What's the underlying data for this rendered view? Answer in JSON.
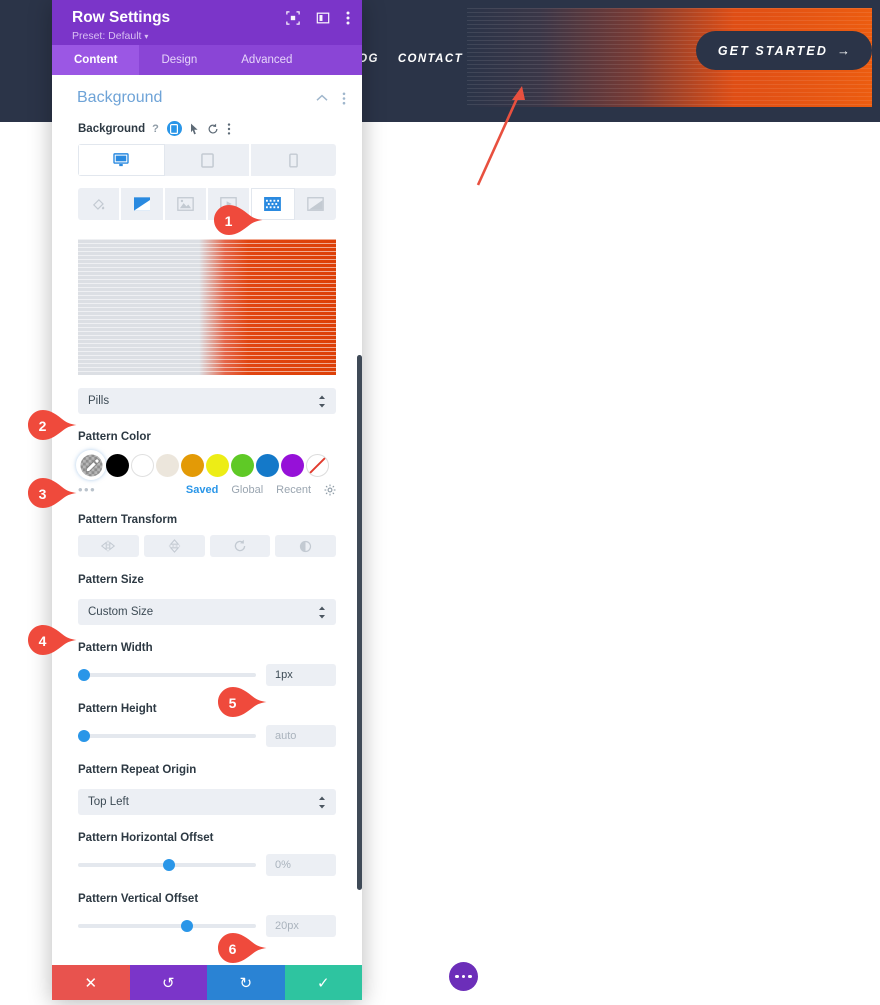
{
  "site": {
    "nav": [
      "BLOG",
      "CONTACT"
    ],
    "cta": {
      "label": "GET STARTED",
      "arrow": "→"
    },
    "fab_icon": "more-dots-icon",
    "colors": {
      "header_bg": "#2b3448",
      "accent_orange": "#ec5c10"
    }
  },
  "modal": {
    "title": "Row Settings",
    "preset": "Preset: Default",
    "preset_caret": "▾",
    "header_icons": [
      "fullscreen-icon",
      "layout-panel-icon",
      "overflow-menu-icon"
    ],
    "tabs": [
      {
        "label": "Content",
        "active": true
      },
      {
        "label": "Design",
        "active": false
      },
      {
        "label": "Advanced",
        "active": false
      }
    ],
    "section": {
      "title": "Background",
      "collapse_icon": "chevron-up-icon",
      "menu_icon": "overflow-menu-icon"
    },
    "background_field": {
      "label": "Background",
      "help_icon": "?",
      "responsive_icon": "responsive-toggle-icon",
      "hover_icon": "hover-cursor-icon",
      "reset_icon": "reset-icon",
      "menu_icon": "overflow-menu-icon"
    },
    "device_tabs": [
      {
        "name": "desktop",
        "active": true
      },
      {
        "name": "tablet",
        "active": false
      },
      {
        "name": "phone",
        "active": false
      }
    ],
    "background_types": [
      {
        "name": "color-fill",
        "state": "inactive"
      },
      {
        "name": "gradient",
        "state": "set"
      },
      {
        "name": "image",
        "state": "inactive"
      },
      {
        "name": "video",
        "state": "inactive"
      },
      {
        "name": "pattern",
        "state": "selected"
      },
      {
        "name": "mask",
        "state": "inactive"
      }
    ],
    "preview_alt": "pattern-preview",
    "pattern_select": {
      "label": "",
      "value": "Pills"
    },
    "pattern_color": {
      "label": "Pattern Color",
      "selected": "eyedropper",
      "swatches": [
        "#000000",
        "#ffffff",
        "#ece6dc",
        "#e39a06",
        "#eded16",
        "#5fc926",
        "#1479c9",
        "#9611d8",
        "none"
      ],
      "more_dots": "•••",
      "tabs": [
        {
          "label": "Saved",
          "active": true
        },
        {
          "label": "Global",
          "active": false
        },
        {
          "label": "Recent",
          "active": false
        }
      ],
      "settings_icon": "gear-icon"
    },
    "pattern_transform": {
      "label": "Pattern Transform",
      "buttons": [
        "flip-horizontal-icon",
        "flip-vertical-icon",
        "rotate-icon",
        "invert-icon"
      ]
    },
    "pattern_size": {
      "label": "Pattern Size",
      "value": "Custom Size"
    },
    "pattern_width": {
      "label": "Pattern Width",
      "value": "1px",
      "is_placeholder": false,
      "slider_pct": 2
    },
    "pattern_height": {
      "label": "Pattern Height",
      "value": "auto",
      "is_placeholder": true,
      "slider_pct": 2
    },
    "pattern_repeat_origin": {
      "label": "Pattern Repeat Origin",
      "value": "Top Left"
    },
    "pattern_horizontal_offset": {
      "label": "Pattern Horizontal Offset",
      "value": "0%",
      "is_placeholder": true,
      "slider_pct": 50
    },
    "pattern_vertical_offset": {
      "label": "Pattern Vertical Offset",
      "value": "20px",
      "is_placeholder": true,
      "slider_pct": 60
    },
    "footer_buttons": [
      {
        "name": "cancel",
        "glyph": "✕"
      },
      {
        "name": "undo",
        "glyph": "↺"
      },
      {
        "name": "redo",
        "glyph": "↻"
      },
      {
        "name": "save",
        "glyph": "✓"
      }
    ]
  },
  "annotations": {
    "marker_color": "#ef4a3c",
    "markers": [
      {
        "num": "1",
        "target": "pattern-background-type-button"
      },
      {
        "num": "2",
        "target": "pattern-select"
      },
      {
        "num": "3",
        "target": "pattern-color-eyedropper"
      },
      {
        "num": "4",
        "target": "pattern-size-select"
      },
      {
        "num": "5",
        "target": "pattern-width-value"
      },
      {
        "num": "6",
        "target": "pattern-vertical-offset-value"
      }
    ],
    "arrow": {
      "color": "#e8503f",
      "points_to": "site-header-pattern"
    }
  }
}
